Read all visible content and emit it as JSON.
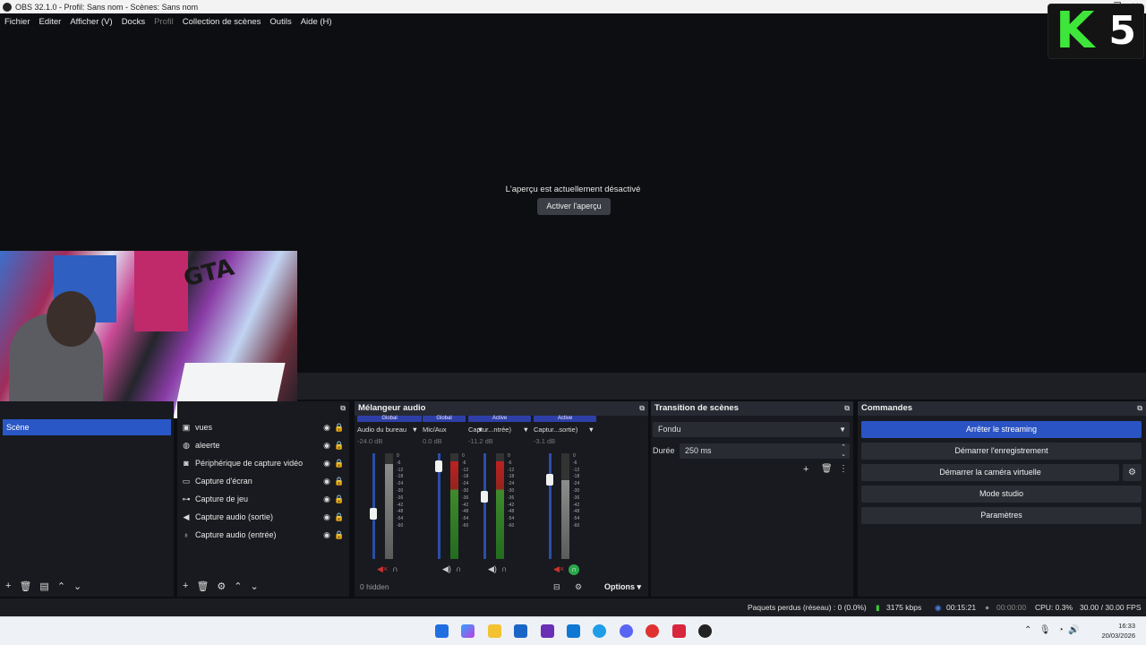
{
  "window": {
    "title": "OBS 32.1.0 - Profil: Sans nom - Scènes: Sans nom"
  },
  "menu": [
    "Fichier",
    "Editer",
    "Afficher (V)",
    "Docks",
    "Profil",
    "Collection de scènes",
    "Outils",
    "Aide (H)"
  ],
  "preview": {
    "message": "L'aperçu est actuellement désactivé",
    "button": "Activer l'aperçu"
  },
  "logo": {
    "letter": "K",
    "number": "5"
  },
  "scenes": {
    "items": [
      "Scène"
    ]
  },
  "sources": {
    "items": [
      {
        "name": "vues",
        "icon": "image-icon"
      },
      {
        "name": "aleerte",
        "icon": "browser-icon"
      },
      {
        "name": "Périphérique de capture vidéo",
        "icon": "camera-icon"
      },
      {
        "name": "Capture d'écran",
        "icon": "monitor-icon"
      },
      {
        "name": "Capture de jeu",
        "icon": "gamepad-icon"
      },
      {
        "name": "Capture audio (sortie)",
        "icon": "speaker-icon"
      },
      {
        "name": "Capture audio (entrée)",
        "icon": "microphone-icon"
      }
    ]
  },
  "mixer": {
    "title": "Mélangeur audio",
    "channels": [
      {
        "badge": "Global",
        "name": "Audio du bureau",
        "db": "-24.0 dB",
        "fader": 0.42,
        "level": 0.9,
        "active_meter": false
      },
      {
        "badge": "Global",
        "name": "Mic/Aux",
        "db": "0.0 dB",
        "fader": 0.92,
        "level": 0.92,
        "active_meter": true
      },
      {
        "badge": "Active",
        "name": "Captur...ntrée)",
        "db": "-11.2 dB",
        "fader": 0.6,
        "level": 0.92,
        "active_meter": true
      },
      {
        "badge": "Active",
        "name": "Captur...sortie)",
        "db": "-3.1 dB",
        "fader": 0.78,
        "level": 0.75,
        "active_meter": false
      }
    ],
    "scale": [
      "0",
      "-6",
      "-12",
      "-18",
      "-24",
      "-30",
      "-36",
      "-42",
      "-48",
      "-54",
      "-60"
    ],
    "hidden": "0 hidden",
    "options": "Options"
  },
  "transition": {
    "title": "Transition de scènes",
    "type": "Fondu",
    "duration_label": "Durée",
    "duration": "250 ms"
  },
  "commands": {
    "title": "Commandes",
    "buttons": [
      "Arrêter le streaming",
      "Démarrer l'enregistrement",
      "Démarrer la caméra virtuelle",
      "Mode studio",
      "Paramètres"
    ]
  },
  "status": {
    "dropped": "Paquets perdus (réseau) : 0 (0.0%)",
    "bitrate": "3175 kbps",
    "stream_time": "00:15:21",
    "rec_time": "00:00:00",
    "cpu": "CPU: 0.3%",
    "fps": "30.00 / 30.00 FPS"
  },
  "taskbar": {
    "time": "16:33",
    "date": "20/03/2026"
  }
}
